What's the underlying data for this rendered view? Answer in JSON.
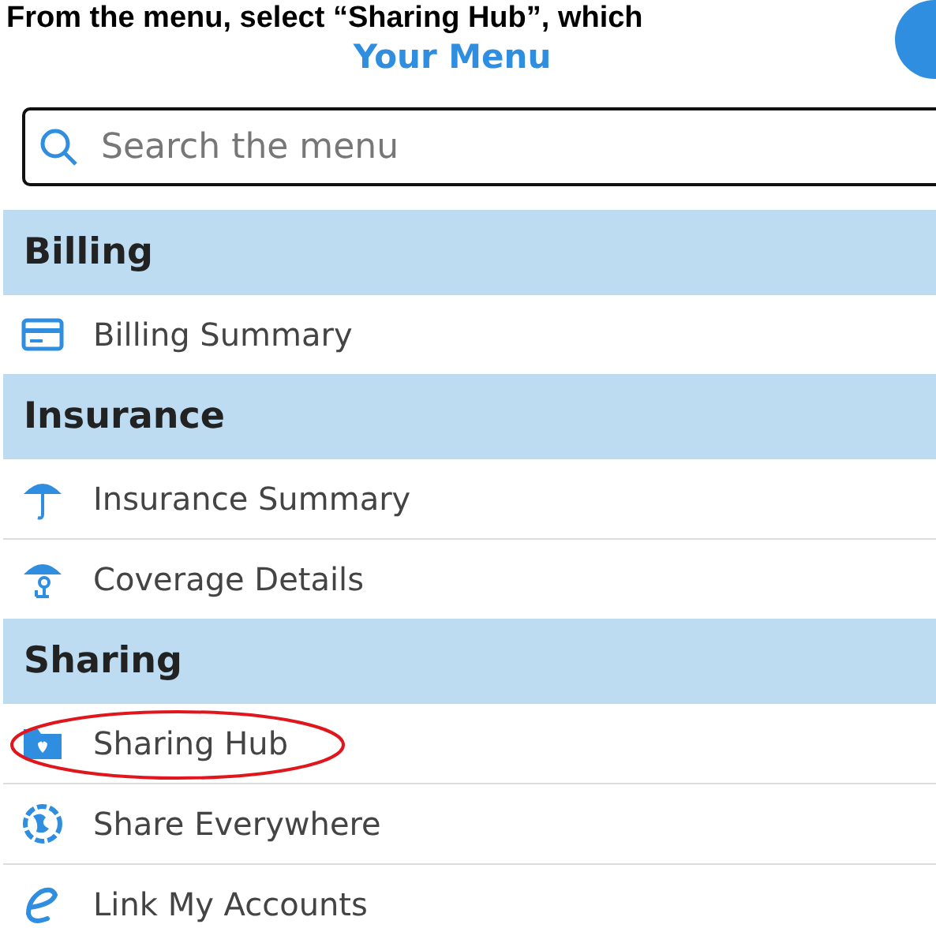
{
  "caption": "From the menu, select “Sharing Hub”, which",
  "title": "Your Menu",
  "search": {
    "placeholder": "Search the menu"
  },
  "sections": [
    {
      "title": "Billing",
      "items": [
        {
          "label": "Billing Summary",
          "highlighted": false
        }
      ]
    },
    {
      "title": "Insurance",
      "items": [
        {
          "label": "Insurance Summary",
          "highlighted": false
        },
        {
          "label": "Coverage Details",
          "highlighted": false
        }
      ]
    },
    {
      "title": "Sharing",
      "items": [
        {
          "label": "Sharing Hub",
          "highlighted": true
        },
        {
          "label": "Share Everywhere",
          "highlighted": false
        },
        {
          "label": "Link My Accounts",
          "highlighted": false
        }
      ]
    }
  ]
}
